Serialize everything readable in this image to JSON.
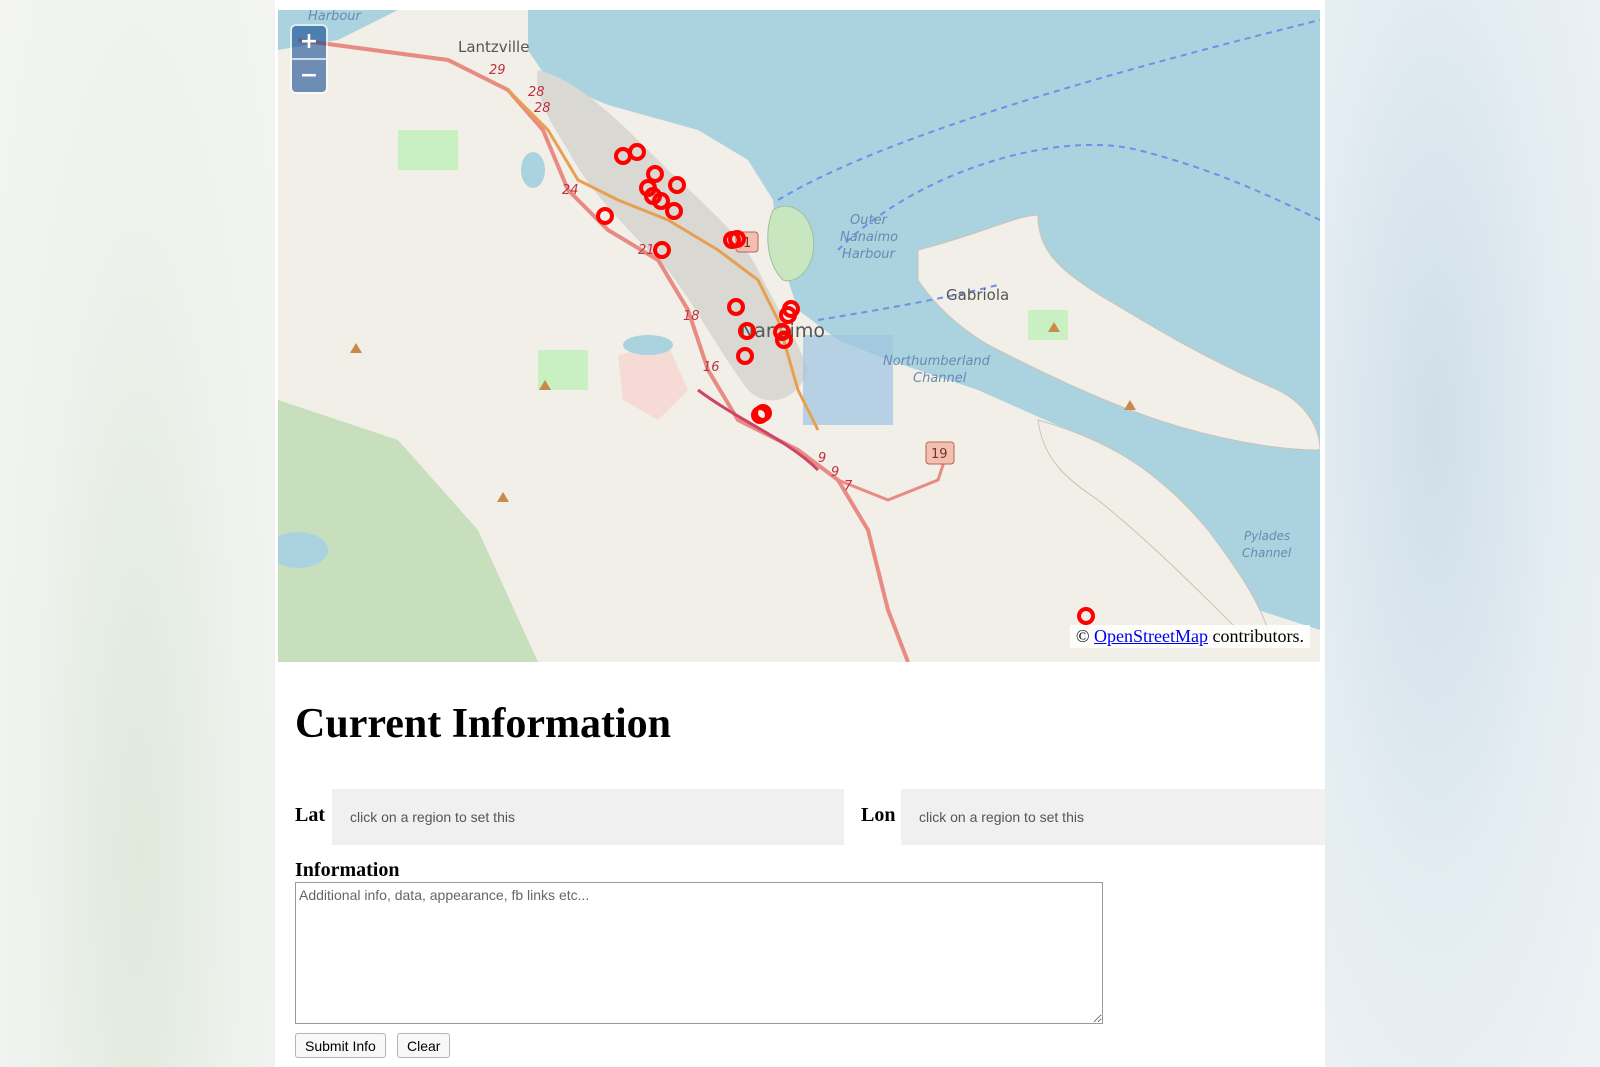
{
  "map": {
    "zoom_in_label": "+",
    "zoom_out_label": "−",
    "place_labels": [
      "Harbour",
      "Lantzville",
      "Nanaimo",
      "Gabriola",
      "Outer",
      "Nanaimo",
      "Harbour",
      "Northumberland",
      "Channel",
      "Pylades",
      "Channel"
    ],
    "route_labels": [
      "29",
      "28",
      "28",
      "24",
      "21",
      "18",
      "16",
      "9",
      "9",
      "7",
      "1",
      "19"
    ],
    "attribution_prefix": "©",
    "attribution_link": "OpenStreetMap",
    "attribution_suffix": "contributors.",
    "marker_color": "#ff0000"
  },
  "form": {
    "heading": "Current Information",
    "lat_label": "Lat",
    "lat_placeholder": "click on a region to set this",
    "lon_label": "Lon",
    "lon_placeholder": "click on a region to set this",
    "info_label": "Information",
    "info_placeholder": "Additional info, data, appearance, fb links etc...",
    "submit_label": "Submit Info",
    "clear_label": "Clear"
  }
}
